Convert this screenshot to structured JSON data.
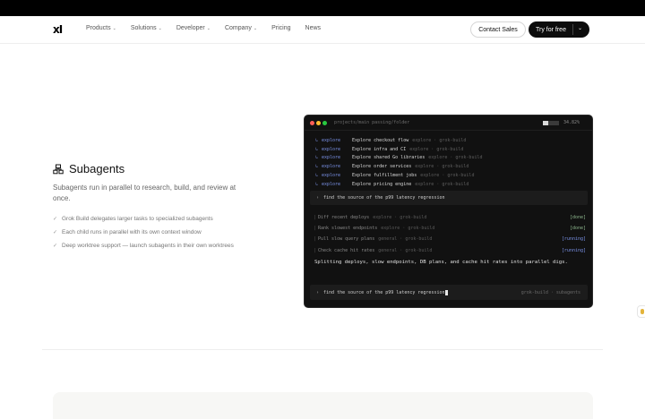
{
  "nav": {
    "logo": "xI",
    "links": [
      {
        "label": "Products",
        "dropdown": true
      },
      {
        "label": "Solutions",
        "dropdown": true
      },
      {
        "label": "Developer",
        "dropdown": true
      },
      {
        "label": "Company",
        "dropdown": true
      },
      {
        "label": "Pricing",
        "dropdown": false
      },
      {
        "label": "News",
        "dropdown": false
      }
    ],
    "contact_sales": "Contact Sales",
    "try_free": "Try for free"
  },
  "feature": {
    "icon": "subagents-icon",
    "title": "Subagents",
    "description": "Subagents run in parallel to research, build, and review at once.",
    "bullets": [
      "Grok Build delegates larger tasks to specialized subagents",
      "Each child runs in parallel with its own context window",
      "Deep worktree support — launch subagents in their own worktrees"
    ]
  },
  "terminal": {
    "path": "projects/main passing/folder",
    "context_usage": 0.3482,
    "context_pct_label": "34.82%",
    "tasks": [
      {
        "kind": "explore",
        "title": "Explore checkout flow",
        "meta": "explore · grok-build"
      },
      {
        "kind": "explore",
        "title": "Explore infra and CI",
        "meta": "explore · grok-build"
      },
      {
        "kind": "explore",
        "title": "Explore shared Go libraries",
        "meta": "explore · grok-build"
      },
      {
        "kind": "explore",
        "title": "Explore order services",
        "meta": "explore · grok-build"
      },
      {
        "kind": "explore",
        "title": "Explore fulfillment jobs",
        "meta": "explore · grok-build"
      },
      {
        "kind": "explore",
        "title": "Explore pricing engine",
        "meta": "explore · grok-build"
      }
    ],
    "prompt": "find the source of the p99 latency regression",
    "runs": [
      {
        "title": "Diff recent deploys",
        "meta": "explore · grok-build",
        "status": "[done]",
        "state": "done"
      },
      {
        "title": "Rank slowest endpoints",
        "meta": "explore · grok-build",
        "status": "[done]",
        "state": "done"
      },
      {
        "title": "Pull slow query plans",
        "meta": "general · grok-build",
        "status": "[running]",
        "state": "running"
      },
      {
        "title": "Check cache hit rates",
        "meta": "general · grok-build",
        "status": "[running]",
        "state": "running"
      }
    ],
    "summary": "Splitting deploys, slow endpoints, DB plans, and cache hit rates into parallel digs.",
    "input_value": "find the source of the p99 latency regression",
    "input_meta": "grok-build · subagents"
  },
  "colors": {
    "terminal_bg": "#111111",
    "accent_blue": "#7b93ea",
    "done_green": "#8fb98f",
    "dot_red": "#ff5f57",
    "dot_yellow": "#febc2e",
    "dot_green": "#28c840"
  }
}
